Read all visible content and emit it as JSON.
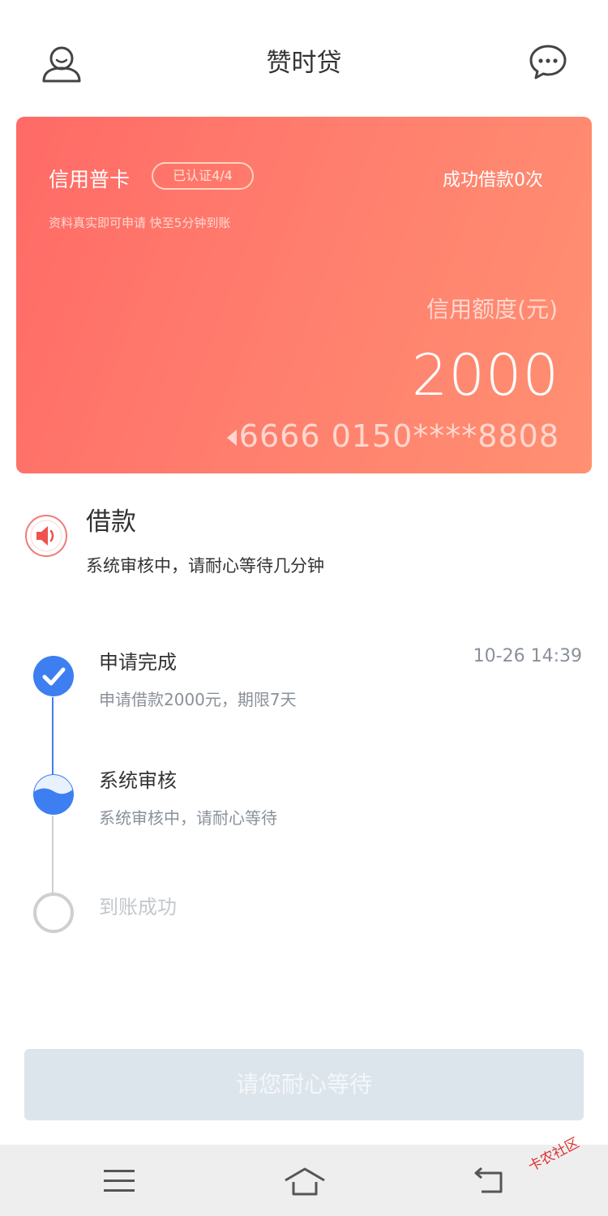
{
  "header": {
    "title": "赞时贷",
    "user_icon": "user-icon",
    "message_icon": "chat-icon"
  },
  "card": {
    "name": "信用普卡",
    "badge": "已认证4/4",
    "success": "成功借款0次",
    "tip": "资料真实即可申请 快至5分钟到账",
    "limit_label": "信用额度(元)",
    "amount": "2000",
    "card_number": "6666 0150****8808"
  },
  "notice": {
    "title": "借款",
    "desc": "系统审核中，请耐心等待几分钟",
    "icon": "speaker-icon"
  },
  "steps": [
    {
      "title": "申请完成",
      "desc": "申请借款2000元，期限7天",
      "time": "10-26 14:39",
      "status": "done"
    },
    {
      "title": "系统审核",
      "desc": "系统审核中，请耐心等待",
      "status": "active"
    },
    {
      "title": "到账成功",
      "status": "pending"
    }
  ],
  "action": {
    "label": "请您耐心等待"
  },
  "watermark": "卡农社区",
  "colors": {
    "card_start": "#ff6a66",
    "card_end": "#ff9072",
    "accent_blue": "#3d7ff0",
    "button_disabled": "#dde5ec"
  }
}
